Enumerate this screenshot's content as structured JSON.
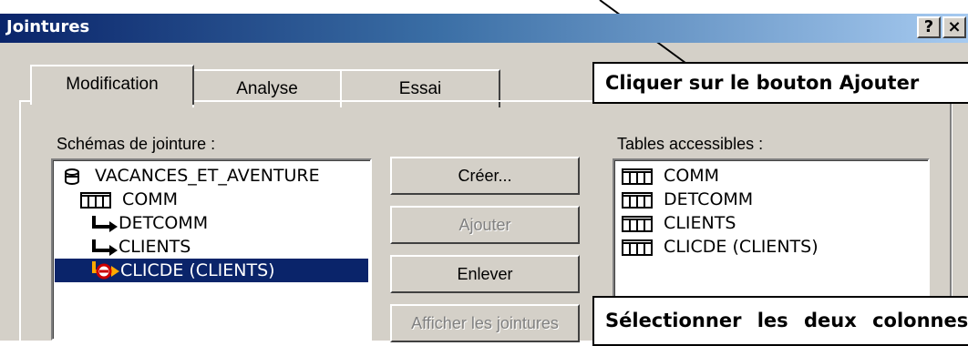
{
  "window": {
    "title": "Jointures",
    "help_label": "?",
    "close_label": "×"
  },
  "tabs": [
    {
      "label": "Modification",
      "active": true
    },
    {
      "label": "Analyse",
      "active": false
    },
    {
      "label": "Essai",
      "active": false
    }
  ],
  "schemas": {
    "label": "Schémas de jointure :",
    "items": [
      {
        "label": "VACANCES_ET_AVENTURE",
        "icon": "database-icon"
      },
      {
        "label": "COMM",
        "icon": "table-icon"
      },
      {
        "label": "DETCOMM",
        "icon": "join-arrow-icon"
      },
      {
        "label": "CLIENTS",
        "icon": "join-arrow-icon"
      },
      {
        "label": "CLICDE (CLIENTS)",
        "icon": "join-error-icon",
        "selected": true
      }
    ]
  },
  "buttons": {
    "create": "Créer...",
    "add": "Ajouter",
    "remove": "Enlever",
    "show_joins": "Afficher les jointures"
  },
  "tables": {
    "label": "Tables accessibles :",
    "items": [
      "COMM",
      "DETCOMM",
      "CLIENTS",
      "CLICDE (CLIENTS)"
    ]
  },
  "callouts": {
    "top": "Cliquer sur le bouton Ajouter",
    "bottom": "Sélectionner les deux colonnes"
  },
  "colors": {
    "selection": "#0a246a",
    "title_gradient_start": "#0a246a",
    "dialog_face": "#d4d0c8"
  }
}
